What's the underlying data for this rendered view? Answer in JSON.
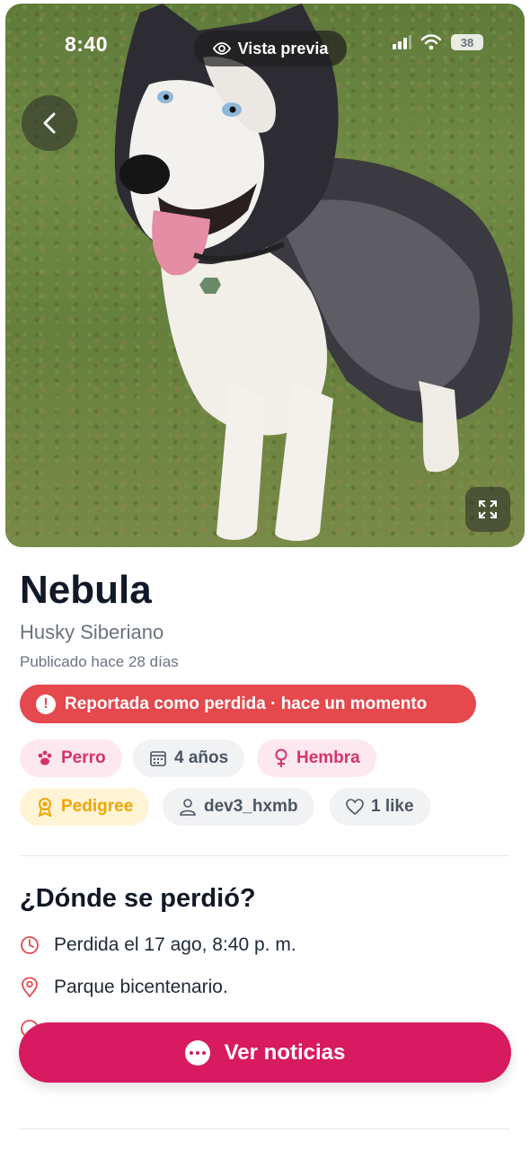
{
  "status_bar": {
    "time": "8:40",
    "battery": "38",
    "preview_label": "Vista previa"
  },
  "pet": {
    "name": "Nebula",
    "breed": "Husky Siberiano",
    "published": "Publicado hace 28 días",
    "lost_banner": "Reportada como perdida · hace un momento",
    "chips": {
      "species": "Perro",
      "age": "4 años",
      "sex": "Hembra",
      "pedigree": "Pedigree",
      "owner": "dev3_hxmb",
      "likes": "1 like"
    }
  },
  "lost_section": {
    "title": "¿Dónde se perdió?",
    "date": "Perdida el 17 ago, 8:40 p. m.",
    "place": "Parque bicentenario."
  },
  "cta": {
    "label": "Ver noticias"
  },
  "colors": {
    "accent": "#d81b60",
    "lost": "#e5484d",
    "pink_chip": "#fde8ef",
    "yellow_chip": "#fff4d6"
  }
}
